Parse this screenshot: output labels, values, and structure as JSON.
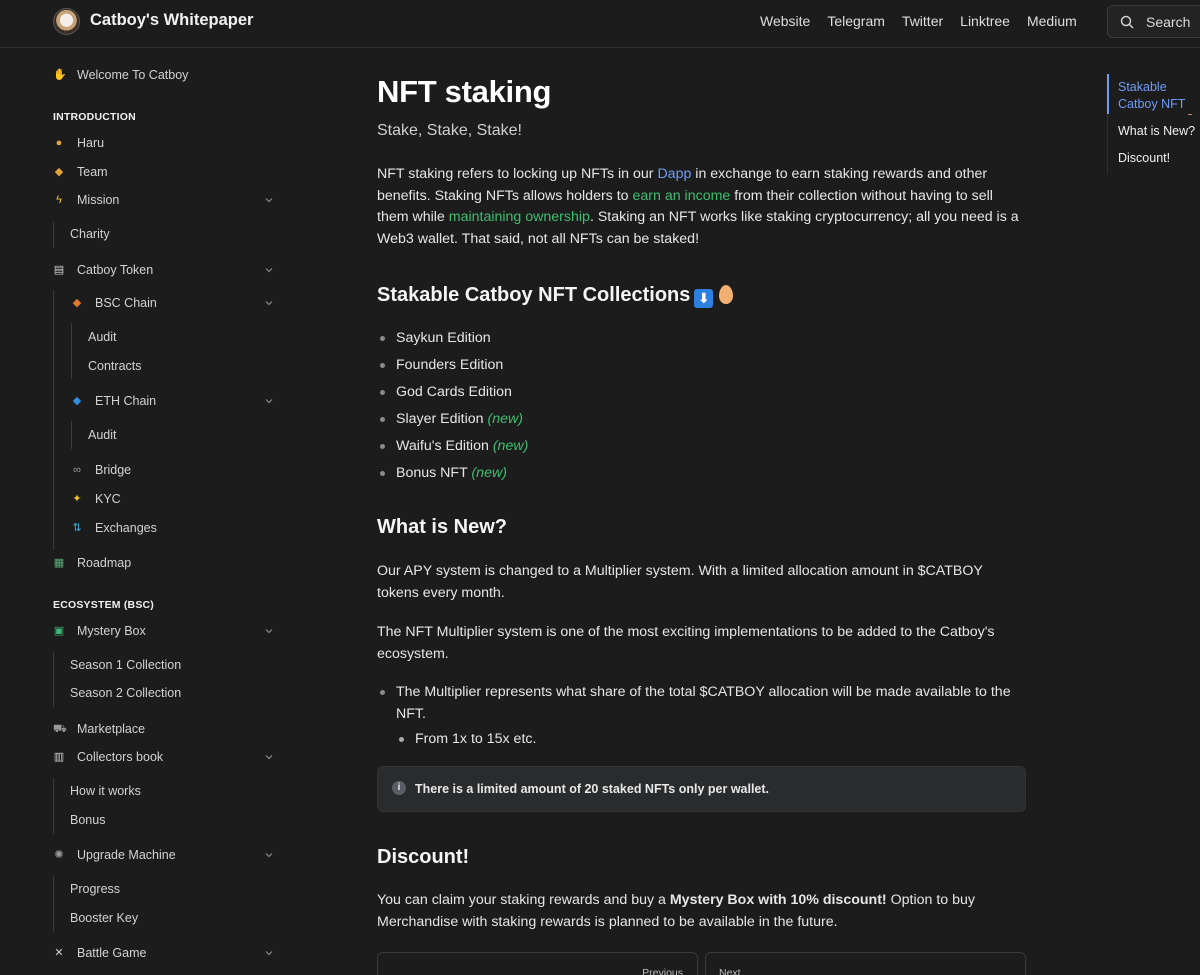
{
  "header": {
    "site_title": "Catboy's Whitepaper",
    "nav": [
      "Website",
      "Telegram",
      "Twitter",
      "Linktree",
      "Medium"
    ],
    "search_label": "Search"
  },
  "sidebar": {
    "welcome": "Welcome To Catboy",
    "sections": {
      "introduction": "INTRODUCTION",
      "ecosystem": "ECOSYSTEM (BSC)"
    },
    "items": {
      "haru": "Haru",
      "team": "Team",
      "mission": "Mission",
      "charity": "Charity",
      "catboy_token": "Catboy Token",
      "bsc_chain": "BSC Chain",
      "audit_bsc": "Audit",
      "contracts": "Contracts",
      "eth_chain": "ETH Chain",
      "audit_eth": "Audit",
      "bridge": "Bridge",
      "kyc": "KYC",
      "exchanges": "Exchanges",
      "roadmap": "Roadmap",
      "mystery_box": "Mystery Box",
      "season1": "Season 1 Collection",
      "season2": "Season 2 Collection",
      "marketplace": "Marketplace",
      "collectors_book": "Collectors book",
      "how_it_works": "How it works",
      "bonus": "Bonus",
      "upgrade_machine": "Upgrade Machine",
      "progress": "Progress",
      "booster_key": "Booster Key",
      "battle_game": "Battle Game"
    }
  },
  "main": {
    "title": "NFT staking",
    "subtitle": "Stake, Stake, Stake!",
    "intro": {
      "t1": "NFT staking refers to locking up NFTs in our ",
      "link_dapp": "Dapp",
      "t2": " in exchange to earn staking rewards and other benefits. Staking NFTs allows holders to ",
      "link_income": "earn an income",
      "t3": " from their collection without having to sell them while ",
      "link_ownership": "maintaining ownership",
      "t4": ". Staking an NFT works like staking cryptocurrency; all you need is a Web3 wallet. That said, not all NFTs can be staked!"
    },
    "collections_heading": "Stakable Catboy NFT Collections",
    "collections": [
      {
        "name": "Saykun Edition",
        "tag": ""
      },
      {
        "name": "Founders Edition",
        "tag": ""
      },
      {
        "name": "God Cards Edition",
        "tag": ""
      },
      {
        "name": "Slayer Edition",
        "tag": "(new)"
      },
      {
        "name": "Waifu's Edition",
        "tag": "(new)"
      },
      {
        "name": "Bonus NFT",
        "tag": "(new)"
      }
    ],
    "whats_new_heading": "What is New?",
    "whats_new_p1": "Our APY system is changed to a Multiplier system. With a limited allocation amount in $CATBOY tokens every month.",
    "whats_new_p2": "The NFT Multiplier system is one of the most exciting implementations to be added to the Catboy's ecosystem.",
    "multiplier_bullet": "The Multiplier represents what share of the total $CATBOY allocation will be made available to the NFT.",
    "multiplier_sub": "From 1x to 15x etc.",
    "hint": "There is a limited amount of 20 staked NFTs only per wallet.",
    "discount_heading": "Discount!",
    "discount_t1": "You can claim your staking rewards and buy a ",
    "discount_bold": "Mystery Box with 10% discount!",
    "discount_t2": " Option to buy Merchandise with staking rewards is planned to be available in the future.",
    "pager_prev": "Previous",
    "pager_next": "Next"
  },
  "toc": {
    "item1": "Stakable Catboy NFT Collections",
    "item2": "What is New?",
    "item3": "Discount!"
  },
  "colors": {
    "background": "#1c1c1c",
    "link_blue": "#6f9cf5",
    "link_green": "#3dbf70"
  }
}
